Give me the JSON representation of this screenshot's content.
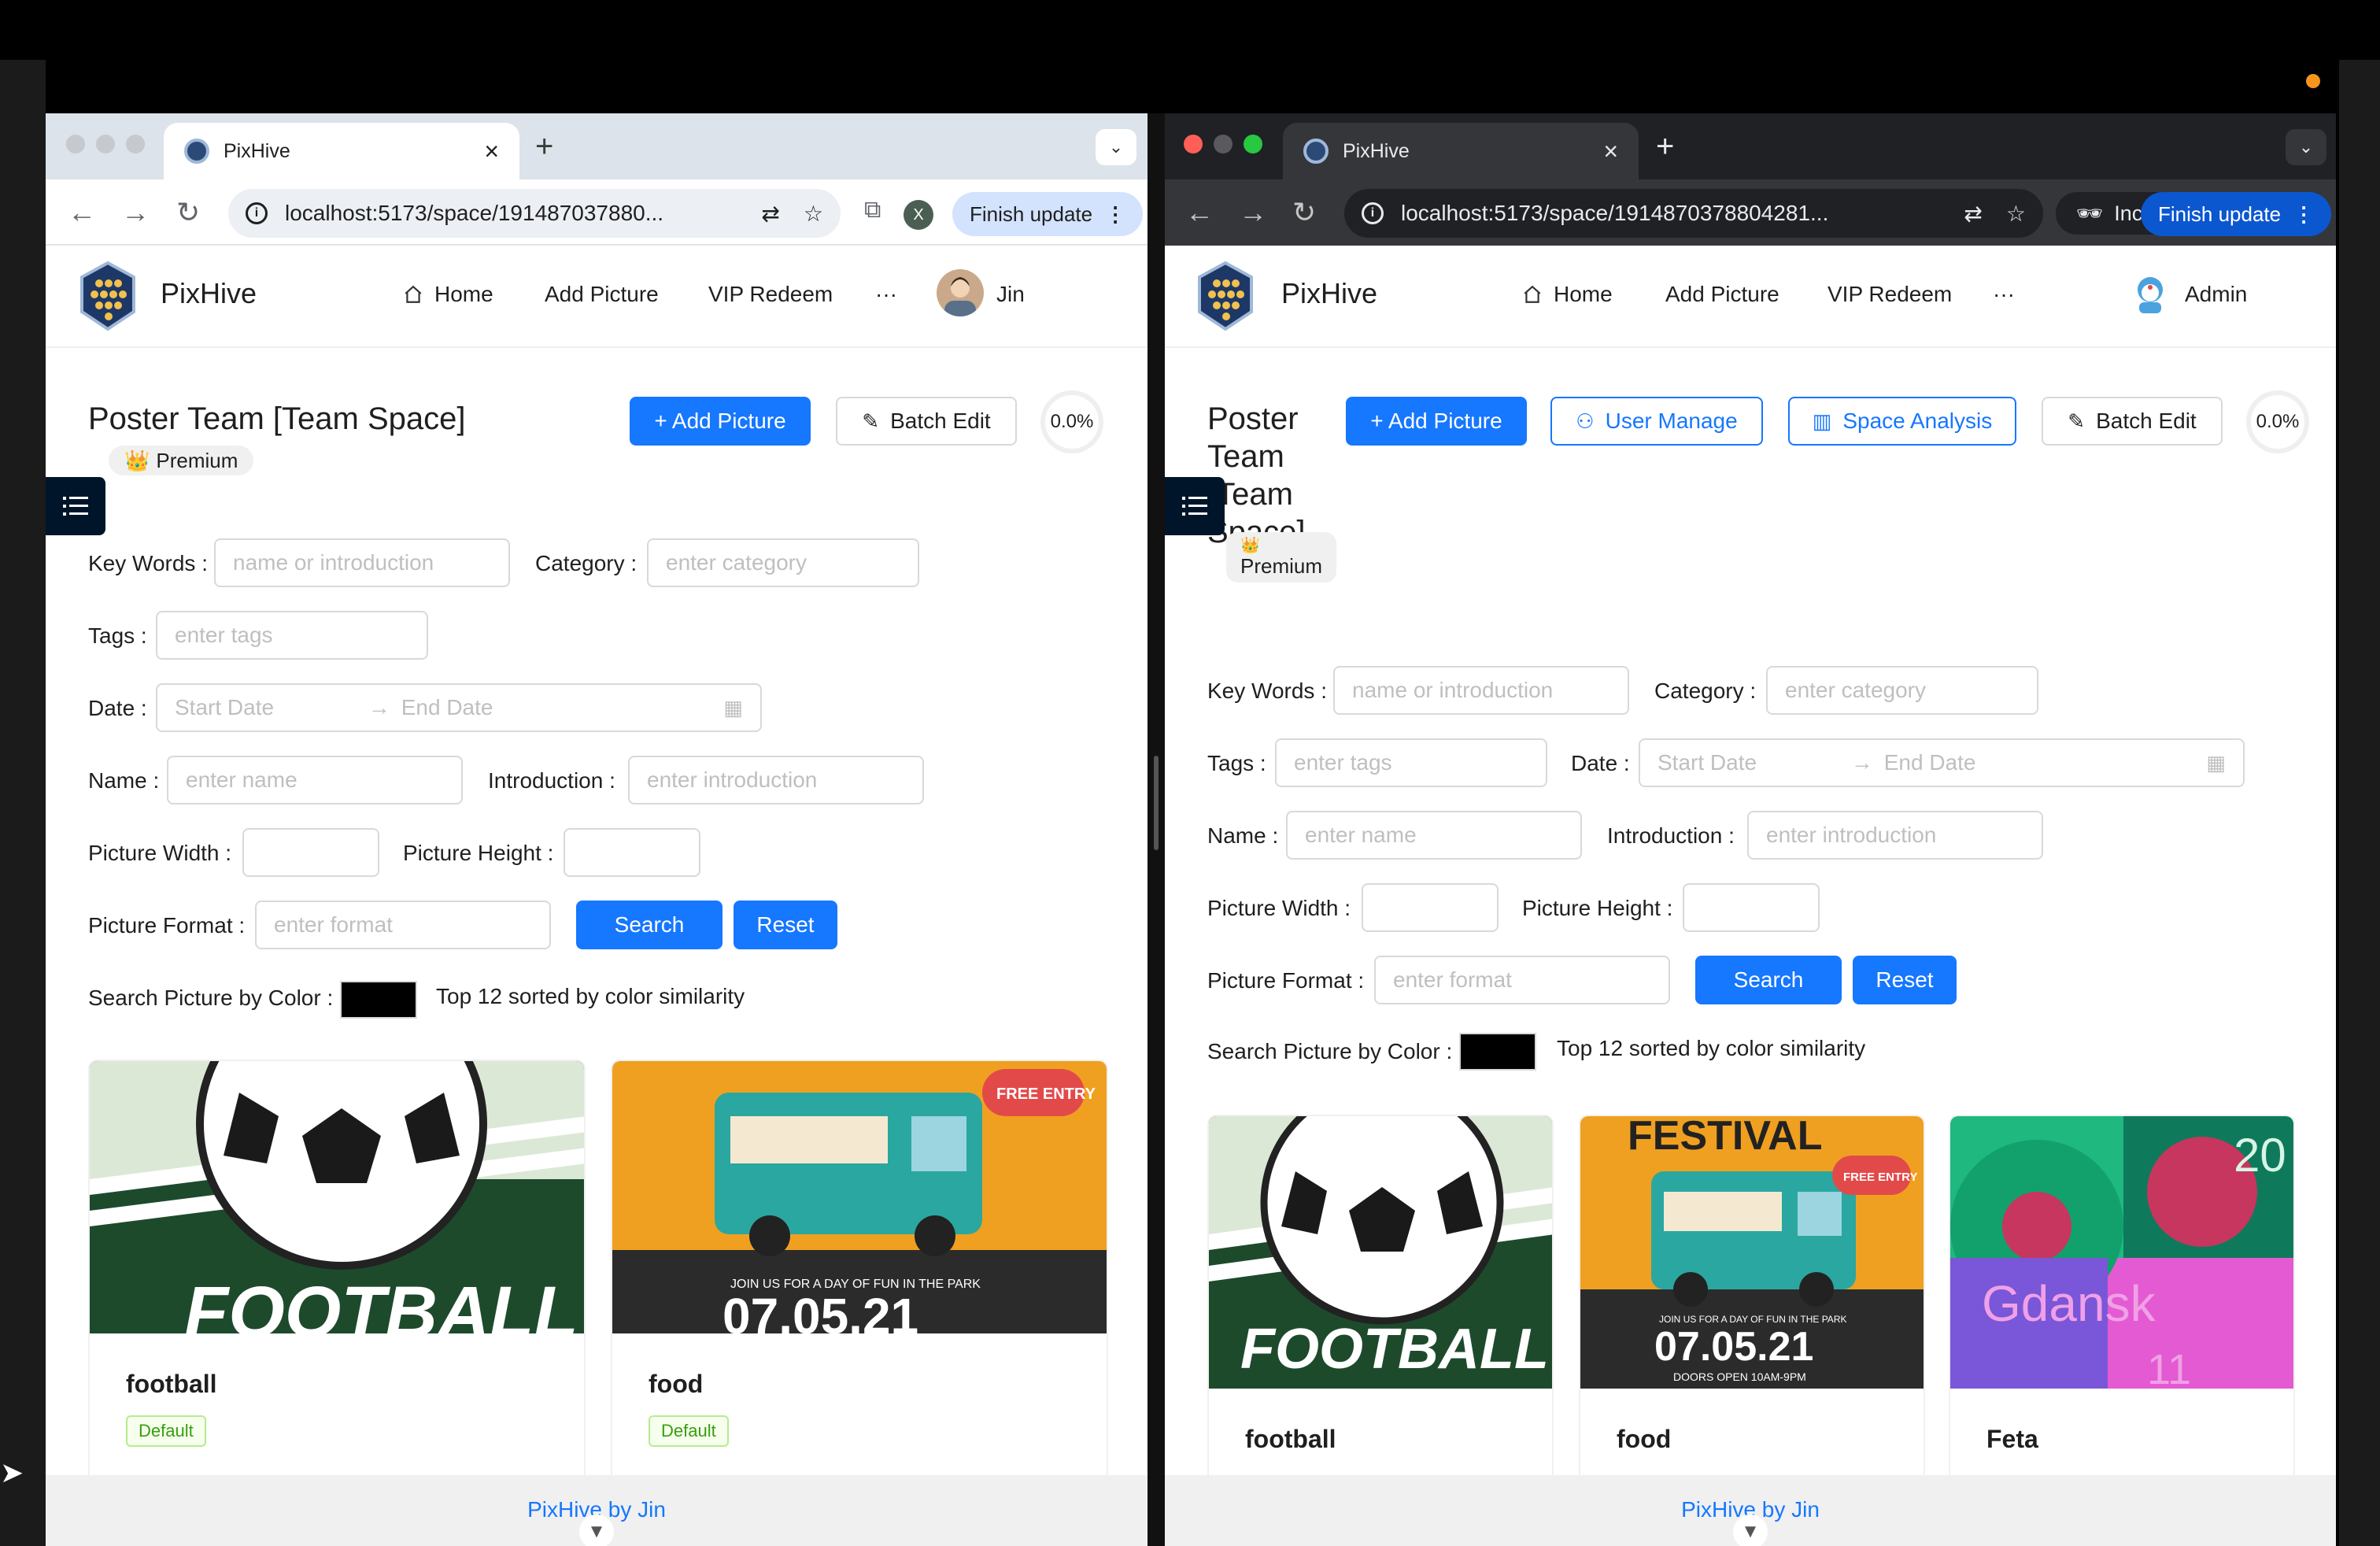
{
  "colors": {
    "primary": "#1677ff",
    "sidebar_toggle": "#001529",
    "tag_green": "#389e0d",
    "orange_dot": "#f7941d"
  },
  "browsers": [
    {
      "mode": "normal",
      "tab": {
        "title": "PixHive",
        "favicon": "pixhive-logo-icon"
      },
      "url": "localhost:5173/space/191487037880...",
      "profile_initial": "X",
      "finish_update": "Finish update",
      "app": {
        "brand": "PixHive",
        "menu": {
          "home": "Home",
          "add_picture": "Add Picture",
          "vip_redeem": "VIP Redeem",
          "more": "···"
        },
        "user": "Jin",
        "title": "Poster Team [Team Space]",
        "badge": "Premium",
        "buttons": {
          "add_picture": "+ Add Picture",
          "batch_edit": "Batch Edit"
        },
        "usage": "0.0%",
        "filters": {
          "keywords_label": "Key Words",
          "keywords_ph": "name or introduction",
          "category_label": "Category",
          "category_ph": "enter category",
          "tags_label": "Tags",
          "tags_ph": "enter tags",
          "date_label": "Date",
          "start_ph": "Start Date",
          "end_ph": "End Date",
          "name_label": "Name",
          "name_ph": "enter name",
          "intro_label": "Introduction",
          "intro_ph": "enter introduction",
          "width_label": "Picture Width",
          "height_label": "Picture Height",
          "format_label": "Picture Format",
          "format_ph": "enter format",
          "search": "Search",
          "reset": "Reset",
          "color_label": "Search Picture by Color",
          "color_value": "#000000",
          "color_hint": "Top 12 sorted by color similarity"
        },
        "pictures": [
          {
            "name": "football",
            "tag": "Default",
            "image": "soccer-ball-poster"
          },
          {
            "name": "food",
            "tag": "Default",
            "image": "food-truck-poster"
          }
        ],
        "footer": "PixHive by Jin"
      }
    },
    {
      "mode": "incognito",
      "tab": {
        "title": "PixHive",
        "favicon": "pixhive-logo-icon"
      },
      "url": "localhost:5173/space/1914870378804281...",
      "incognito_label": "Incognito",
      "finish_update": "Finish update",
      "app": {
        "brand": "PixHive",
        "menu": {
          "home": "Home",
          "add_picture": "Add Picture",
          "vip_redeem": "VIP Redeem",
          "more": "···"
        },
        "user": "Admin",
        "title_lines": [
          "Poster",
          "Team",
          "[Team",
          "Space]"
        ],
        "badge": "Premium",
        "buttons": {
          "add_picture": "+ Add Picture",
          "user_manage": "User Manage",
          "space_analysis": "Space Analysis",
          "batch_edit": "Batch Edit"
        },
        "usage": "0.0%",
        "filters": {
          "keywords_label": "Key Words",
          "keywords_ph": "name or introduction",
          "category_label": "Category",
          "category_ph": "enter category",
          "tags_label": "Tags",
          "tags_ph": "enter tags",
          "date_label": "Date",
          "start_ph": "Start Date",
          "end_ph": "End Date",
          "name_label": "Name",
          "name_ph": "enter name",
          "intro_label": "Introduction",
          "intro_ph": "enter introduction",
          "width_label": "Picture Width",
          "height_label": "Picture Height",
          "format_label": "Picture Format",
          "format_ph": "enter format",
          "search": "Search",
          "reset": "Reset",
          "color_label": "Search Picture by Color",
          "color_value": "#000000",
          "color_hint": "Top 12 sorted by color similarity"
        },
        "pictures": [
          {
            "name": "football",
            "image": "soccer-ball-poster"
          },
          {
            "name": "food",
            "image": "food-truck-festival-poster"
          },
          {
            "name": "Feta",
            "image": "feta-gdansk-poster"
          }
        ],
        "footer": "PixHive by Jin"
      }
    }
  ],
  "posters": {
    "football_text": "FOOTBALL",
    "food_date": "07.05.21",
    "food_tagline": "JOIN US FOR A DAY OF FUN IN THE PARK",
    "food_free": "FREE ENTRY",
    "food_festival": "FESTIVAL",
    "food_doors": "DOORS OPEN 10AM-9PM",
    "feta_text": "Gdansk",
    "feta_year": "20",
    "feta_num": "11"
  }
}
